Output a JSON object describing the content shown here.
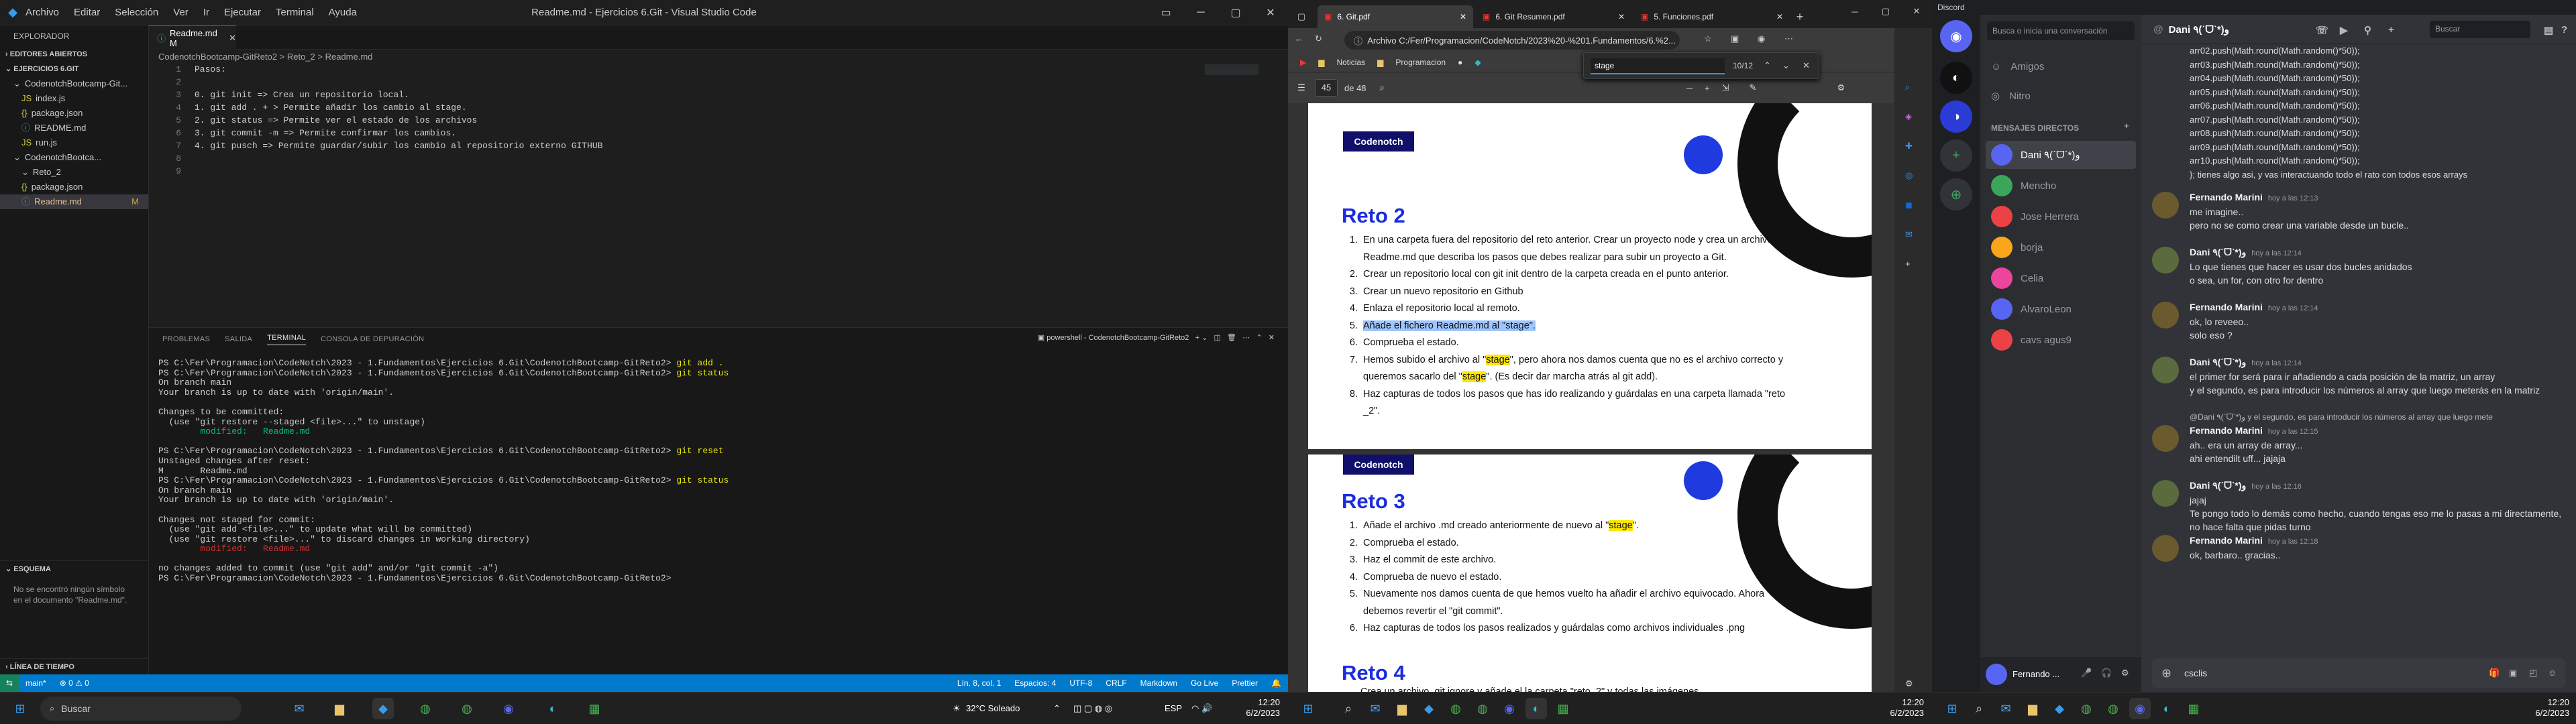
{
  "vscode": {
    "title": "Readme.md - Ejercicios 6.Git - Visual Studio Code",
    "menu": [
      "Archivo",
      "Editar",
      "Selección",
      "Ver",
      "Ir",
      "Ejecutar",
      "Terminal",
      "Ayuda"
    ],
    "explorer_label": "EXPLORADOR",
    "open_editors": "EDITORES ABIERTOS",
    "workspace": "EJERCICIOS 6.GIT",
    "tree": [
      {
        "label": "CodenotchBootcamp-Git...",
        "kind": "folder",
        "indent": 1
      },
      {
        "label": "index.js",
        "kind": "js",
        "indent": 2
      },
      {
        "label": "package.json",
        "kind": "json",
        "indent": 2
      },
      {
        "label": "README.md",
        "kind": "md",
        "indent": 2
      },
      {
        "label": "run.js",
        "kind": "js",
        "indent": 2
      },
      {
        "label": "CodenotchBootca...",
        "kind": "folder",
        "indent": 1
      },
      {
        "label": "Reto_2",
        "kind": "folder",
        "indent": 2
      },
      {
        "label": "package.json",
        "kind": "json",
        "indent": 2
      },
      {
        "label": "Readme.md",
        "kind": "md",
        "indent": 2,
        "mark": "M"
      }
    ],
    "outline_label": "ESQUEMA",
    "outline_msg": "No se encontró ningún símbolo en el documento \"Readme.md\".",
    "timeline_label": "LÍNEA DE TIEMPO",
    "tab": "Readme.md M",
    "breadcrumb": "CodenotchBootcamp-GitReto2 > Reto_2 > Readme.md",
    "code_lines": [
      "Pasos:",
      "",
      "0. git init => Crea un repositorio local.",
      "1. git add . + > Permite añadir los cambio al stage.",
      "2. git status => Permite ver el estado de los archivos",
      "3. git commit -m => Permite confirmar los cambios.",
      "4. git pusch => Permite guardar/subir los cambio al repositorio externo GITHUB",
      "",
      ""
    ],
    "panel_tabs": [
      "PROBLEMAS",
      "SALIDA",
      "TERMINAL",
      "CONSOLA DE DEPURACIÓN"
    ],
    "panel_active": "TERMINAL",
    "shell_label": "powershell - CodenotchBootcamp-GitReto2",
    "terminal": [
      {
        "t": "prompt",
        "text": "PS C:\\Fer\\Programacion\\CodeNotch\\2023 - 1.Fundamentos\\Ejercicios 6.Git\\CodenotchBootcamp-GitReto2> ",
        "cmd": "git add ."
      },
      {
        "t": "prompt",
        "text": "PS C:\\Fer\\Programacion\\CodeNotch\\2023 - 1.Fundamentos\\Ejercicios 6.Git\\CodenotchBootcamp-GitReto2> ",
        "cmd": "git status"
      },
      {
        "t": "out",
        "text": "On branch main"
      },
      {
        "t": "out",
        "text": "Your branch is up to date with 'origin/main'."
      },
      {
        "t": "out",
        "text": ""
      },
      {
        "t": "out",
        "text": "Changes to be committed:"
      },
      {
        "t": "out",
        "text": "  (use \"git restore --staged <file>...\" to unstage)"
      },
      {
        "t": "green",
        "text": "        modified:   Readme.md"
      },
      {
        "t": "out",
        "text": ""
      },
      {
        "t": "prompt",
        "text": "PS C:\\Fer\\Programacion\\CodeNotch\\2023 - 1.Fundamentos\\Ejercicios 6.Git\\CodenotchBootcamp-GitReto2> ",
        "cmd": "git reset"
      },
      {
        "t": "out",
        "text": "Unstaged changes after reset:"
      },
      {
        "t": "out",
        "text": "M       Readme.md"
      },
      {
        "t": "prompt",
        "text": "PS C:\\Fer\\Programacion\\CodeNotch\\2023 - 1.Fundamentos\\Ejercicios 6.Git\\CodenotchBootcamp-GitReto2> ",
        "cmd": "git status"
      },
      {
        "t": "out",
        "text": "On branch main"
      },
      {
        "t": "out",
        "text": "Your branch is up to date with 'origin/main'."
      },
      {
        "t": "out",
        "text": ""
      },
      {
        "t": "out",
        "text": "Changes not staged for commit:"
      },
      {
        "t": "out",
        "text": "  (use \"git add <file>...\" to update what will be committed)"
      },
      {
        "t": "out",
        "text": "  (use \"git restore <file>...\" to discard changes in working directory)"
      },
      {
        "t": "red",
        "text": "        modified:   Readme.md"
      },
      {
        "t": "out",
        "text": ""
      },
      {
        "t": "out",
        "text": "no changes added to commit (use \"git add\" and/or \"git commit -a\")"
      },
      {
        "t": "prompt",
        "text": "PS C:\\Fer\\Programacion\\CodeNotch\\2023 - 1.Fundamentos\\Ejercicios 6.Git\\CodenotchBootcamp-GitReto2> ",
        "cmd": ""
      }
    ],
    "status_left": [
      "main*",
      "⊗ 0 ⚠ 0"
    ],
    "status_right": [
      "Lín. 8, col. 1",
      "Espacios: 4",
      "UTF-8",
      "CRLF",
      "Markdown",
      "Go Live",
      "Prettier"
    ]
  },
  "edge": {
    "tabs": [
      "6. Git.pdf",
      "6. Git Resumen.pdf",
      "5. Funciones.pdf"
    ],
    "url": "Archivo   C:/Fer/Programacion/CodeNotch/2023%20-%201.Fundamentos/6.%2...",
    "favorites": [
      "Noticias",
      "Programacion"
    ],
    "find_text": "stage",
    "find_count": "10/12",
    "page_num": "45",
    "page_total": "de 48",
    "reto2_title": "Reto 2",
    "reto2_items": [
      "En una carpeta fuera del repositorio del reto anterior. Crear un proyecto node y  crea un archivo Readme.md que describa los pasos que debes realizar para subir un proyecto a Git.",
      "Crear un repositorio local con git init dentro de la carpeta creada en el punto anterior.",
      "Crear un nuevo repositorio en Github",
      "Enlaza el repositorio local al remoto.",
      "Añade el fichero Readme.md al \"stage\".",
      "Comprueba el estado.",
      "Hemos subido el archivo al \"stage\", pero ahora nos damos cuenta que no es el archivo correcto y queremos sacarlo del \"stage\". (Es decir dar marcha atrás al git add).",
      "Haz capturas de todos los pasos que has ido realizando y guárdalas en una carpeta llamada \"reto _2\"."
    ],
    "reto3_title": "Reto 3",
    "reto3_items": [
      "Añade el archivo .md creado anteriormente de nuevo al \"stage\".",
      "Comprueba el estado.",
      "Haz el commit de este archivo.",
      "Comprueba de nuevo el estado.",
      "Nuevamente nos damos cuenta de que hemos vuelto ha añadir el archivo equivocado. Ahora debemos revertir el \"git commit\".",
      "Haz capturas de todos los pasos realizados y guárdalas como archivos individuales .png"
    ],
    "reto4_title": "Reto 4",
    "reto4_partial": "Crea un archivo .git ignore y añade el la carpeta \"reto_2\" y todas las imágenes",
    "logo": "Codenotch"
  },
  "discord": {
    "app_title": "Discord",
    "search_placeholder": "Busca o inicia una conversación",
    "friends": "Amigos",
    "nitro": "Nitro",
    "dm_header": "MENSAJES DIRECTOS",
    "dms": [
      {
        "name": "Dani ٩(ˊᗜˋ*)و",
        "color": "#5865f2",
        "sel": true
      },
      {
        "name": "Mencho",
        "color": "#3ba55c"
      },
      {
        "name": "Jose Herrera",
        "color": "#ed4245"
      },
      {
        "name": "borja",
        "color": "#faa61a"
      },
      {
        "name": "Celia",
        "color": "#eb459e"
      },
      {
        "name": "AlvaroLeon",
        "color": "#5865f2"
      },
      {
        "name": "cavs agus9",
        "color": "#ed4245"
      }
    ],
    "user_name": "Fernando ...",
    "chat_title": "Dani ٩(ˊᗜˋ*)و",
    "chat_search": "Buscar",
    "code_block": [
      "arr02.push(Math.round(Math.random()*50));",
      "arr03.push(Math.round(Math.random()*50));",
      "arr04.push(Math.round(Math.random()*50));",
      "arr05.push(Math.round(Math.random()*50));",
      "arr06.push(Math.round(Math.random()*50));",
      "arr07.push(Math.round(Math.random()*50));",
      "arr08.push(Math.round(Math.random()*50));",
      "arr09.push(Math.round(Math.random()*50));",
      "arr10.push(Math.round(Math.random()*50));",
      "}; tienes algo asi, y vas interactuando todo el rato con todos esos arrays"
    ],
    "messages": [
      {
        "author": "Fernando Marini",
        "time": "hoy a las 12:13",
        "lines": [
          "me imagine..",
          "pero no se como crear una variable desde un bucle.."
        ]
      },
      {
        "author": "Dani ٩(ˊᗜˋ*)و",
        "time": "hoy a las 12:14",
        "lines": [
          "Lo que tienes que hacer es usar dos bucles anidados",
          "o sea, un for, con otro for dentro"
        ]
      },
      {
        "author": "Fernando Marini",
        "time": "hoy a las 12:14",
        "lines": [
          "ok, lo reveeo..",
          "solo eso ?"
        ]
      },
      {
        "author": "Dani ٩(ˊᗜˋ*)و",
        "time": "hoy a las 12:14",
        "lines": [
          "el primer for será para ir añadiendo a cada posición de la matriz, un array",
          "y el segundo, es para introducir los números al array que luego meterás en la matriz"
        ]
      },
      {
        "author": "Fernando Marini",
        "time": "hoy a las 12:15",
        "reply": "@Dani ٩(ˊᗜˋ*)و y el segundo, es para introducir los números al array que luego mete",
        "lines": [
          "ah.. era un array de array...",
          "ahi entendilt uff... jajaja"
        ]
      },
      {
        "author": "Dani ٩(ˊᗜˋ*)و",
        "time": "hoy a las 12:16",
        "lines": [
          "jajaj",
          "Te pongo todo lo demás como hecho, cuando tengas eso me lo pasas a mi directamente, no hace falta que pidas turno"
        ]
      },
      {
        "author": "Fernando Marini",
        "time": "hoy a las 12:18",
        "lines": [
          "ok, barbaro.. gracias.."
        ]
      }
    ],
    "input_text": "csclis"
  },
  "taskbar": {
    "search": "Buscar",
    "weather": "32°C  Soleado",
    "lang": "ESP",
    "time": "12:20",
    "date": "6/2/2023",
    "time2": "12:20",
    "date2": "6/2/2023",
    "time3": "12:20",
    "date3": "6/2/2023"
  },
  "colors": {
    "vs_status": "#007acc",
    "accent_blue": "#1a2be0",
    "discord_bg": "#313338"
  }
}
